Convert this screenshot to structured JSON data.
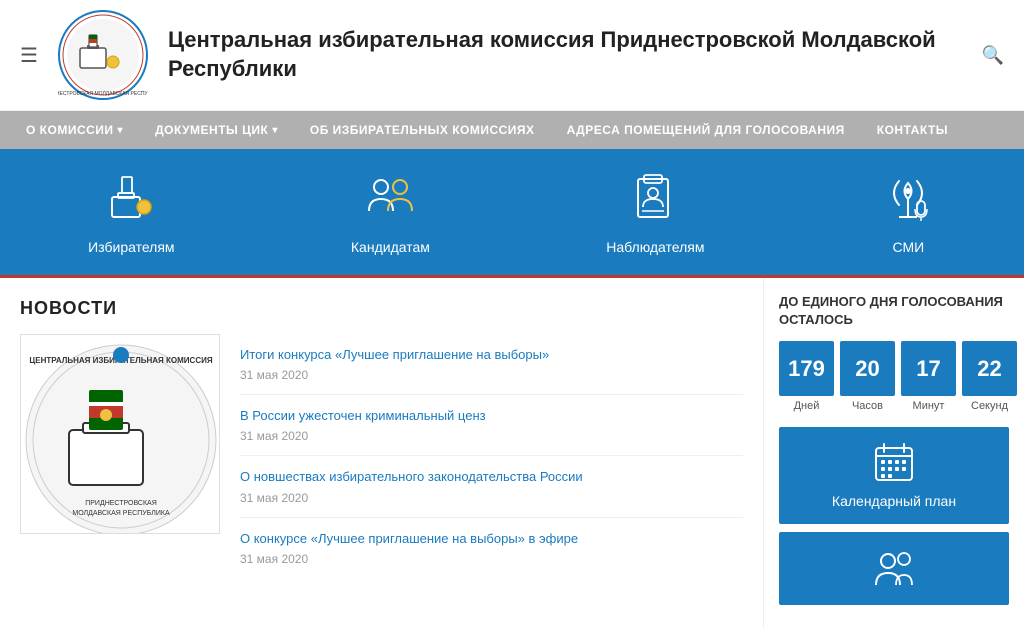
{
  "header": {
    "title": "Центральная избирательная комиссия\nПриднестровской Молдавской Республики",
    "search_placeholder": "Поиск"
  },
  "nav": {
    "items": [
      {
        "label": "О КОМИССИИ",
        "has_dropdown": true
      },
      {
        "label": "ДОКУМЕНТЫ ЦИК",
        "has_dropdown": true
      },
      {
        "label": "ОБ ИЗБИРАТЕЛЬНЫХ КОМИССИЯХ",
        "has_dropdown": false
      },
      {
        "label": "АДРЕСА ПОМЕЩЕНИЙ ДЛЯ ГОЛОСОВАНИЯ",
        "has_dropdown": false
      },
      {
        "label": "КОНТАКТЫ",
        "has_dropdown": false
      }
    ]
  },
  "banner": {
    "items": [
      {
        "label": "Избирателям",
        "icon": "🗳️"
      },
      {
        "label": "Кандидатам",
        "icon": "👥"
      },
      {
        "label": "Наблюдателям",
        "icon": "📋"
      },
      {
        "label": "СМИ",
        "icon": "📡"
      }
    ]
  },
  "news": {
    "section_title": "НОВОСТИ",
    "items": [
      {
        "title": "Итоги конкурса «Лучшее приглашение на выборы»",
        "date": "31 мая 2020"
      },
      {
        "title": "В России ужесточен криминальный ценз",
        "date": "31 мая 2020"
      },
      {
        "title": "О новшествах избирательного законодательства России",
        "date": "31 мая 2020"
      },
      {
        "title": "О конкурсе «Лучшее приглашение на выборы» в эфире",
        "date": "31 мая 2020"
      }
    ]
  },
  "sidebar": {
    "countdown_title": "ДО ЕДИНОГО ДНЯ\nГОЛОСОВАНИЯ ОСТАЛОСЬ",
    "countdown": {
      "days_value": "179",
      "days_label": "Дней",
      "hours_value": "20",
      "hours_label": "Часов",
      "minutes_value": "17",
      "minutes_label": "Минут",
      "seconds_value": "22",
      "seconds_label": "Секунд"
    },
    "cards": [
      {
        "label": "Календарный план",
        "icon": "📅"
      },
      {
        "label": "",
        "icon": "👥"
      }
    ]
  }
}
